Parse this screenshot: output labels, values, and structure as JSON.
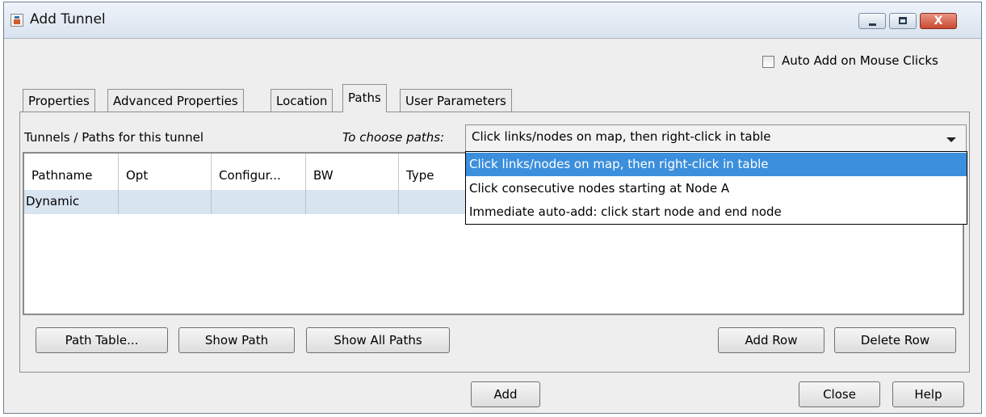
{
  "window": {
    "title": "Add Tunnel",
    "close_glyph": "X"
  },
  "auto_add": {
    "label": "Auto Add on Mouse Clicks",
    "checked": false
  },
  "tabs": [
    {
      "label": "Properties",
      "active": false
    },
    {
      "label": "Advanced Properties",
      "active": false
    },
    {
      "label": "Location",
      "active": false
    },
    {
      "label": "Paths",
      "active": true
    },
    {
      "label": "User Parameters",
      "active": false
    }
  ],
  "paths_panel": {
    "tunnels_label": "Tunnels / Paths for this tunnel",
    "choose_label": "To choose paths:",
    "combo_value": "Click links/nodes on map, then right-click in table",
    "options": [
      "Click links/nodes on map, then right-click in table",
      "Click consecutive nodes starting at Node A",
      "Immediate auto-add: click start node and end node"
    ],
    "table": {
      "columns": [
        "Pathname",
        "Opt",
        "Configur...",
        "BW",
        "Type"
      ],
      "rows": [
        [
          "Dynamic",
          "",
          "",
          "",
          ""
        ]
      ]
    },
    "buttons": {
      "path_table": "Path Table...",
      "show_path": "Show Path",
      "show_all_paths": "Show All Paths",
      "add_row": "Add Row",
      "delete_row": "Delete Row"
    }
  },
  "footer": {
    "add": "Add",
    "close": "Close",
    "help": "Help"
  },
  "colors": {
    "selection": "#3c8fdc",
    "row_highlight": "#d9e4f1",
    "window_bg": "#eeeeee"
  }
}
